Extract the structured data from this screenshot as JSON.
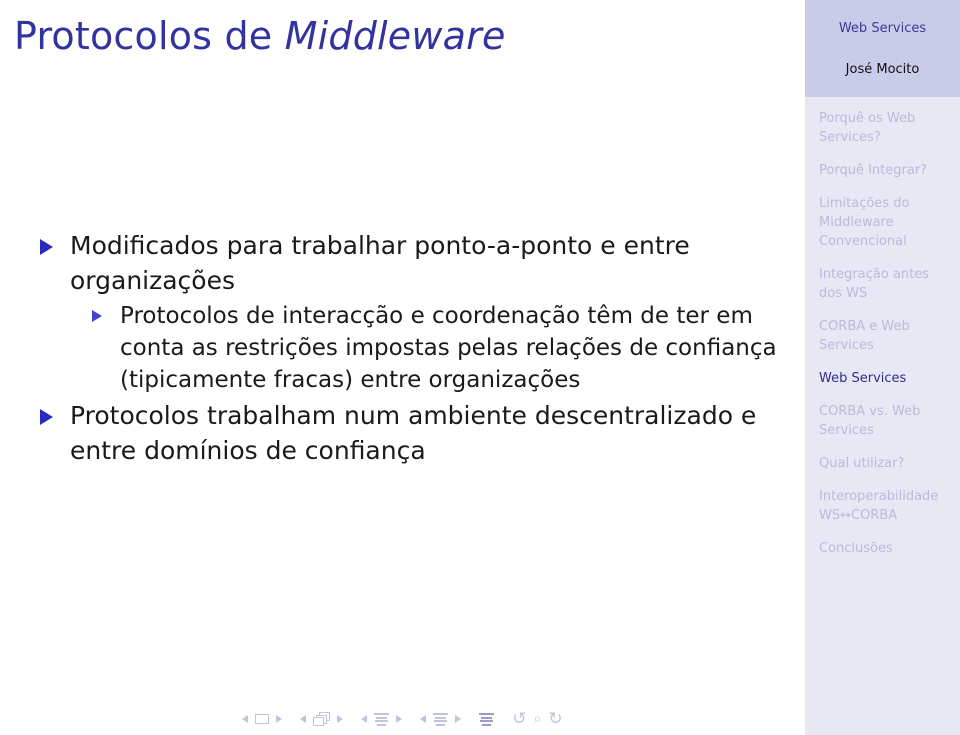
{
  "slide": {
    "title_plain": "Protocolos de ",
    "title_emphasis": "Middleware"
  },
  "content": {
    "bullets": [
      {
        "level": 1,
        "text": "Modificados para trabalhar ponto-a-ponto e entre organizações",
        "children": [
          {
            "level": 2,
            "text": "Protocolos de interacção e coordenação têm de ter em conta as restrições impostas pelas relações de confiança (tipicamente fracas) entre organizações"
          }
        ]
      },
      {
        "level": 1,
        "text": "Protocolos trabalham num ambiente descentralizado e entre domínios de confiança",
        "children": []
      }
    ]
  },
  "sidebar": {
    "doc_title": "Web Services",
    "author": "José Mocito",
    "nav_items": [
      {
        "label": "Porquê os Web Services?",
        "active": false
      },
      {
        "label": "Porquê Integrar?",
        "active": false
      },
      {
        "label": "Limitações do Middleware Convencional",
        "active": false
      },
      {
        "label": "Integração antes dos WS",
        "active": false
      },
      {
        "label": "CORBA e Web Services",
        "active": false
      },
      {
        "label": "Web Services",
        "active": true
      },
      {
        "label": "CORBA vs. Web Services",
        "active": false
      },
      {
        "label": "Qual utilizar?",
        "active": false
      },
      {
        "label": "Interoperabilidade WS↔CORBA",
        "active": false
      },
      {
        "label": "Conclusões",
        "active": false
      }
    ]
  },
  "navbar": {
    "groups": [
      {
        "name": "slide",
        "icon": "slide-icon"
      },
      {
        "name": "frame",
        "icon": "frame-stack-icon"
      },
      {
        "name": "subsection",
        "icon": "lines-icon"
      },
      {
        "name": "section",
        "icon": "lines-icon"
      }
    ],
    "presentation_icon": "lines-icon",
    "back_glyph": "↺",
    "search_glyph": "⌕",
    "forward_glyph": "↻"
  },
  "colors": {
    "title": "#3333a0",
    "bullet_level1": "#2b2bc0",
    "bullet_level2": "#4343cf",
    "sidebar_bg": "#e7e8f4",
    "sidebar_header_bg": "#c9cbe9",
    "sidebar_active": "#2e2e8f",
    "sidebar_inactive": "#b9bbdd",
    "navbar_icon": "#c2c4de"
  }
}
